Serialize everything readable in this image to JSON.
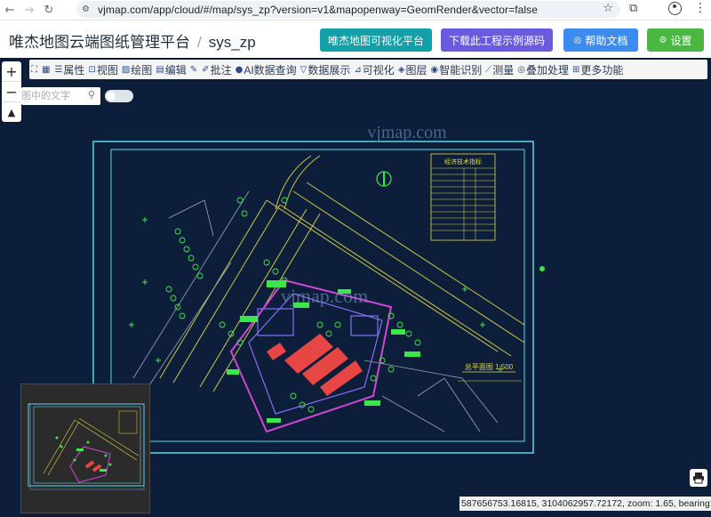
{
  "browser": {
    "url": "vjmap.com/app/cloud/#/map/sys_zp?version=v1&mapopenway=GeomRender&vector=false",
    "icons": [
      "back-icon",
      "forward-icon",
      "reload-icon",
      "site-info-icon",
      "bookmark-star-icon",
      "extensions-icon",
      "profile-icon",
      "menu-icon"
    ]
  },
  "header": {
    "app_name": "唯杰地图云端图纸管理平台",
    "separator": "/",
    "map_name": "sys_zp",
    "btn_visualization": "唯杰地图可视化平台",
    "btn_download": "下载此工程示例源码",
    "btn_help": "帮助文档",
    "btn_settings": "设置",
    "colors": {
      "visualization": "#14a0a8",
      "download": "#6a5ae0",
      "help": "#3c8cf0",
      "settings": "#49b740"
    }
  },
  "toolbar": {
    "items": [
      {
        "label": "",
        "icon": "fullscreen-icon"
      },
      {
        "label": "",
        "icon": "qrcode-icon"
      },
      {
        "label": "属性",
        "icon": "properties-icon"
      },
      {
        "label": "视图",
        "icon": "view-icon"
      },
      {
        "label": "绘图",
        "icon": "draw-icon"
      },
      {
        "label": "编辑",
        "icon": "edit-icon"
      },
      {
        "label": "",
        "icon": "note-icon"
      },
      {
        "label": "批注",
        "icon": "annotate-icon"
      },
      {
        "label": "AI数据查询",
        "icon": "ai-query-icon"
      },
      {
        "label": "数据展示",
        "icon": "data-display-icon"
      },
      {
        "label": "可视化",
        "icon": "chart-icon"
      },
      {
        "label": "图层",
        "icon": "layers-icon"
      },
      {
        "label": "智能识别",
        "icon": "recognition-icon"
      },
      {
        "label": "测量",
        "icon": "measure-icon"
      },
      {
        "label": "叠加处理",
        "icon": "overlay-icon"
      },
      {
        "label": "更多功能",
        "icon": "more-icon"
      }
    ]
  },
  "map": {
    "search_placeholder": "图中的文字",
    "watermark": "vjmap.com",
    "drawing_title": "总平面图 1:500",
    "table_title": "经济技术指标",
    "coordinates": "587656753.16815, 3104062957.72172, zoom: 1.65, bearing: 0.00",
    "background_color": "#0c1e3a"
  }
}
